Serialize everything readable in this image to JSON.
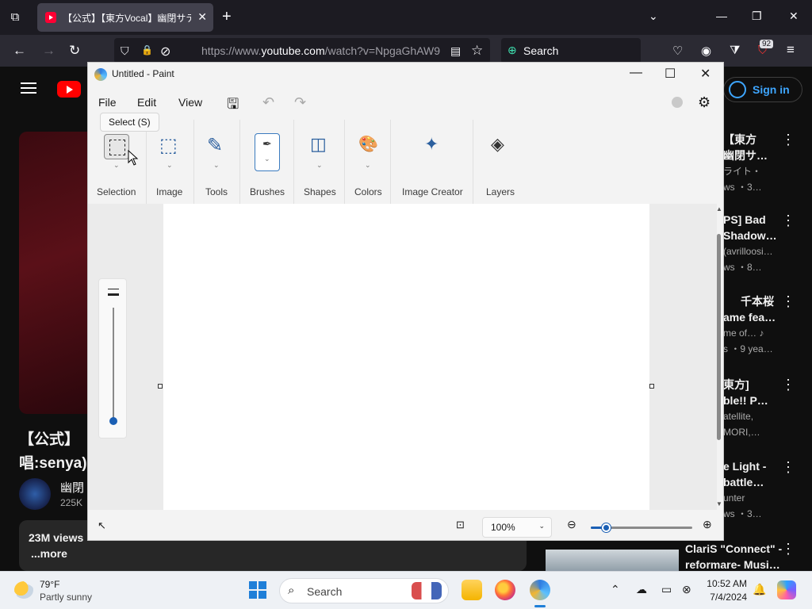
{
  "browser": {
    "tab": {
      "title": "【公式】【東方Vocal】幽閉サテライト"
    },
    "url_prefix": "https://www.",
    "url_domain": "youtube.com",
    "url_rest": "/watch?v=NpgaGhAW9",
    "search_placeholder": "Search",
    "extension_badge": "92",
    "icons": {
      "tab_list": "⧉",
      "new_tab": "+",
      "tabs_down": "⌄",
      "minimize": "—",
      "restore": "❐",
      "close": "✕",
      "back": "←",
      "forward": "→",
      "reload": "↻",
      "shield": "⛉",
      "lock": "🔒",
      "tracking": "⊘",
      "reader": "▤",
      "star": "☆",
      "search": "⊕",
      "pocket": "♡",
      "account": "◉",
      "extensions": "⧩",
      "menu": "≡"
    }
  },
  "youtube": {
    "video_title_line1": "【公式】",
    "video_title_line2": "唱:senya)",
    "channel_name": "幽閉",
    "channel_subs": "225K",
    "views": "23M views",
    "more": "...more",
    "signin": "Sign in",
    "recommendations": [
      {
        "line1": "【東方",
        "line2": "幽閉サ…",
        "line3": "ライト・",
        "line4": "ws ・3…"
      },
      {
        "line1": "PS] Bad",
        "line2": "Shadow…",
        "line3": "(avrilloosi…",
        "line4": "ws ・8…"
      },
      {
        "line1": "千本桜",
        "line2": "ame fea…",
        "line3": "me of… ♪",
        "line4": "s ・9 yea…"
      },
      {
        "line1": "東方]",
        "line2": "ble!! P…",
        "line3": "atellite,",
        "line4": "MORI,…"
      },
      {
        "line1": "e Light -",
        "line2": "battle…",
        "line3": "unter",
        "line4": "ws ・3…"
      }
    ],
    "last_rec": {
      "line1": "ClariS \"Connect\" -",
      "line2": "reformare- Musi…"
    }
  },
  "paint": {
    "title": "Untitled - Paint",
    "menus": [
      "File",
      "Edit",
      "View"
    ],
    "tooltip": "Select (S)",
    "ribbon_groups": [
      "Selection",
      "Image",
      "Tools",
      "Brushes",
      "Shapes",
      "Colors",
      "Image Creator",
      "Layers"
    ],
    "zoom": "100%",
    "zoom_fraction": 0.15,
    "icons": {
      "save": "🖫",
      "undo": "↶",
      "redo": "↷",
      "settings": "⚙",
      "minimize": "—",
      "maximize": "☐",
      "close": "✕",
      "image": "⬚",
      "tools": "✎",
      "shapes": "◫",
      "colors": "🎨",
      "image_creator": "✦",
      "layers": "◈",
      "chevron": "⌄",
      "cursor": "↖",
      "fit": "⊡",
      "zoom_out": "⊖",
      "zoom_in": "⊕",
      "scroll_up": "▲",
      "scroll_down": "▼"
    }
  },
  "taskbar": {
    "temperature": "79°F",
    "condition": "Partly sunny",
    "search": "Search",
    "time": "10:52 AM",
    "date": "7/4/2024",
    "icons": {
      "chevron_up": "⌃",
      "onedrive": "☁",
      "display": "▭",
      "network": "⊗",
      "bell": "🔔",
      "search": "⌕"
    }
  }
}
